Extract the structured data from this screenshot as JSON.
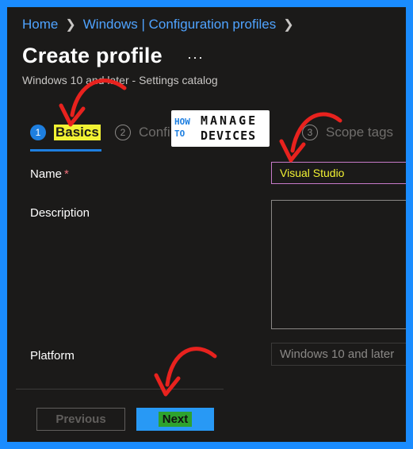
{
  "breadcrumb": {
    "home": "Home",
    "section": "Windows | Configuration profiles"
  },
  "page": {
    "title": "Create profile",
    "more": "···",
    "subtitle": "Windows 10 and later - Settings catalog"
  },
  "steps": [
    {
      "number": "1",
      "label": "Basics"
    },
    {
      "number": "2",
      "label": "Confi"
    },
    {
      "number": "3",
      "label": "Scope tags"
    }
  ],
  "logo": {
    "how": "HOW",
    "to": "TO",
    "manage": "MANAGE",
    "devices": "DEVICES"
  },
  "form": {
    "name_label": "Name",
    "required_mark": "*",
    "name_value": "Visual Studio",
    "description_label": "Description",
    "description_value": "",
    "platform_label": "Platform",
    "platform_value": "Windows 10 and later"
  },
  "footer": {
    "previous_label": "Previous",
    "next_label": "Next"
  },
  "colors": {
    "accent": "#1e7fe0",
    "annotation_red": "#e8221e",
    "highlight_yellow": "#f2f233",
    "frame_border": "#1a8cff"
  }
}
